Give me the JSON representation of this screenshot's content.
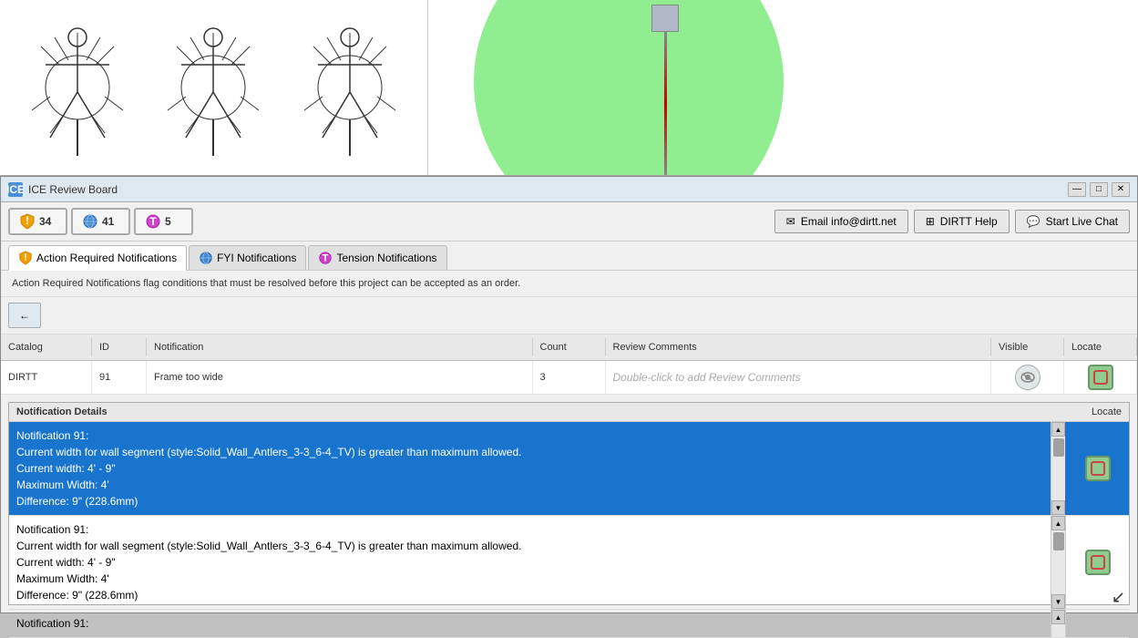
{
  "canvas": {
    "label": "canvas area"
  },
  "window": {
    "title": "ICE Review Board",
    "icon_label": "ICE",
    "controls": {
      "minimize": "—",
      "maximize": "□",
      "close": "✕"
    }
  },
  "toolbar": {
    "badges": [
      {
        "id": "action-required",
        "icon": "shield",
        "count": "34"
      },
      {
        "id": "fyi",
        "icon": "globe",
        "count": "41"
      },
      {
        "id": "tension",
        "icon": "tension",
        "count": "5"
      }
    ],
    "buttons": [
      {
        "id": "email",
        "icon": "email",
        "label": "Email info@dirtt.net"
      },
      {
        "id": "help",
        "icon": "help",
        "label": "DIRTT Help"
      },
      {
        "id": "chat",
        "icon": "chat",
        "label": "Start Live Chat"
      }
    ]
  },
  "tabs": [
    {
      "id": "action-required",
      "label": "Action Required Notifications",
      "active": true
    },
    {
      "id": "fyi",
      "label": "FYI Notifications",
      "active": false
    },
    {
      "id": "tension",
      "label": "Tension Notifications",
      "active": false
    }
  ],
  "description": "Action Required Notifications flag conditions that must be resolved before this project can be accepted as an order.",
  "back_btn": "←",
  "table": {
    "headers": [
      "Catalog",
      "ID",
      "Notification",
      "Count",
      "Review Comments",
      "Visible",
      "Locate"
    ],
    "rows": [
      {
        "catalog": "DIRTT",
        "id": "91",
        "notification": "Frame too wide",
        "count": "3",
        "review_comments": "Double-click to add Review Comments",
        "visible": true,
        "locate": true
      }
    ]
  },
  "notif_panel": {
    "title": "Notification Details",
    "locate_label": "Locate",
    "rows": [
      {
        "id": "notif-1",
        "selected": true,
        "lines": [
          "Notification 91:",
          "Current width for wall segment (style:Solid_Wall_Antlers_3-3_6-4_TV) is greater than maximum allowed.",
          "Current width: 4' - 9\"",
          "Maximum Width: 4'",
          "Difference: 9\" (228.6mm)"
        ]
      },
      {
        "id": "notif-2",
        "selected": false,
        "lines": [
          "Notification 91:",
          "Current width for wall segment (style:Solid_Wall_Antlers_3-3_6-4_TV) is greater than maximum allowed.",
          "Current width: 4' - 9\"",
          "Maximum Width: 4'",
          "Difference: 9\" (228.6mm)"
        ]
      },
      {
        "id": "notif-3",
        "selected": false,
        "lines": [
          "Notification 91:"
        ]
      }
    ]
  }
}
